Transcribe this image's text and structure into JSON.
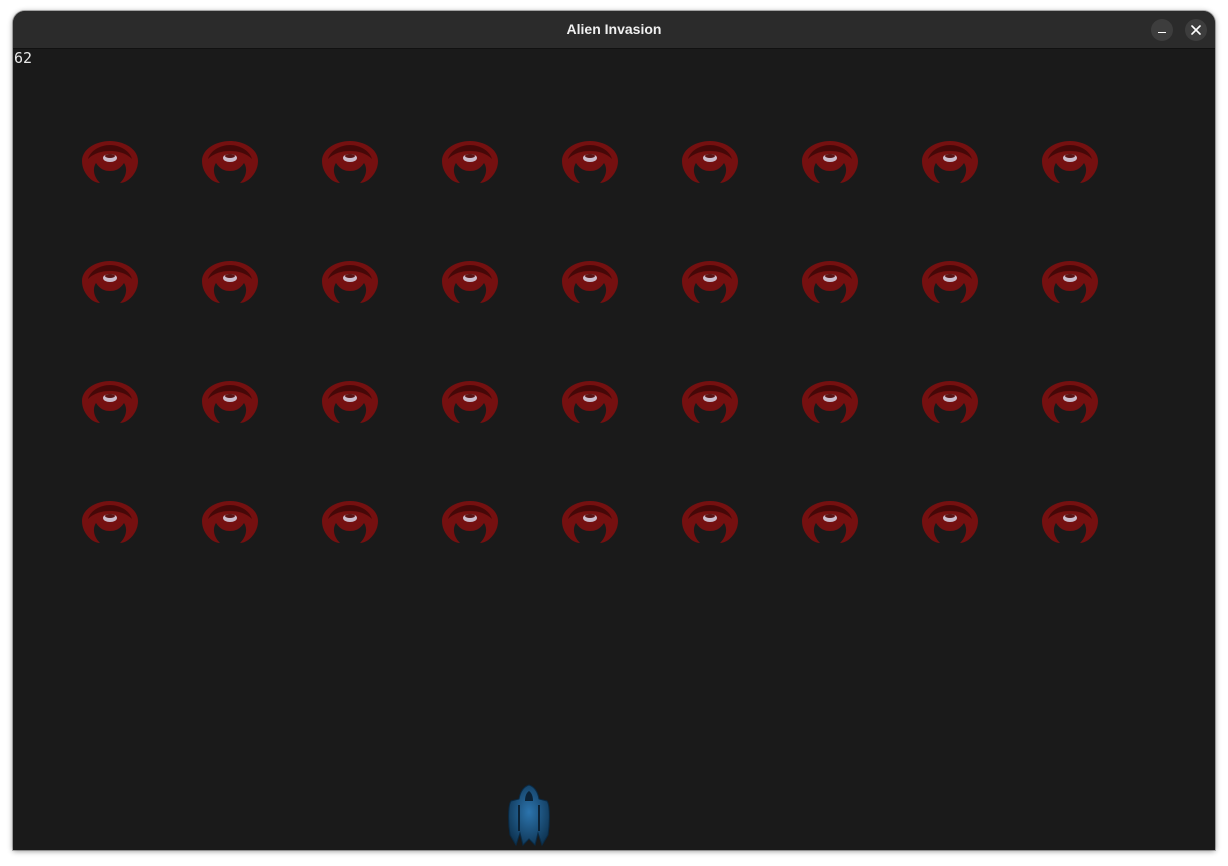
{
  "window": {
    "title": "Alien Invasion",
    "controls": [
      "minimize-icon",
      "close-icon"
    ]
  },
  "game": {
    "score": "62",
    "alien_fleet": {
      "rows": 4,
      "columns": 9,
      "alien_color": "#7a1010",
      "alien_highlight": "#c9b8c8"
    },
    "ship": {
      "color": "#1e5a8a"
    },
    "background_color": "#1a1a1a"
  }
}
